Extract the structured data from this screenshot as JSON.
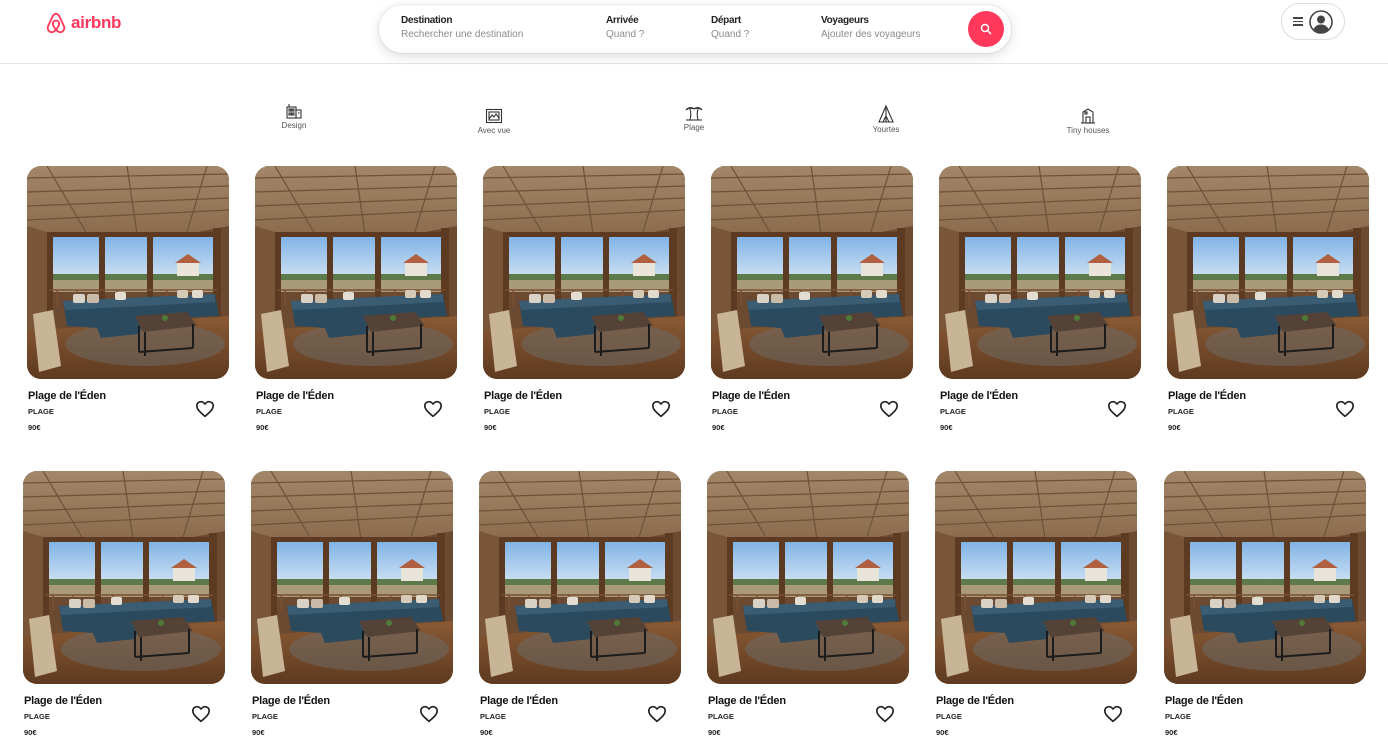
{
  "brand": {
    "name": "airbnb",
    "color": "#ff385c"
  },
  "search": {
    "destination": {
      "label": "Destination",
      "value": "Rechercher une destination"
    },
    "arrival": {
      "label": "Arrivée",
      "value": "Quand ?"
    },
    "departure": {
      "label": "Départ",
      "value": "Quand ?"
    },
    "guests": {
      "label": "Voyageurs",
      "value": "Ajouter des voyageurs"
    },
    "button_icon": "search-icon"
  },
  "user_menu": {
    "icons": [
      "menu-icon",
      "account-icon"
    ]
  },
  "categories": [
    {
      "label": "Design",
      "icon": "design-building-icon"
    },
    {
      "label": "Avec vue",
      "icon": "view-frame-icon"
    },
    {
      "label": "Plage",
      "icon": "beach-palm-icon"
    },
    {
      "label": "Yourtes",
      "icon": "yurt-tent-icon"
    },
    {
      "label": "Tiny houses",
      "icon": "tiny-house-icon"
    }
  ],
  "listings": [
    {
      "title": "Plage de l'Éden",
      "type": "PLAGE",
      "price": "90€"
    },
    {
      "title": "Plage de l'Éden",
      "type": "PLAGE",
      "price": "90€"
    },
    {
      "title": "Plage de l'Éden",
      "type": "PLAGE",
      "price": "90€"
    },
    {
      "title": "Plage de l'Éden",
      "type": "PLAGE",
      "price": "90€"
    },
    {
      "title": "Plage de l'Éden",
      "type": "PLAGE",
      "price": "90€"
    },
    {
      "title": "Plage de l'Éden",
      "type": "PLAGE",
      "price": "90€"
    },
    {
      "title": "Plage de l'Éden",
      "type": "PLAGE",
      "price": "90€"
    },
    {
      "title": "Plage de l'Éden",
      "type": "PLAGE",
      "price": "90€"
    },
    {
      "title": "Plage de l'Éden",
      "type": "PLAGE",
      "price": "90€"
    },
    {
      "title": "Plage de l'Éden",
      "type": "PLAGE",
      "price": "90€"
    },
    {
      "title": "Plage de l'Éden",
      "type": "PLAGE",
      "price": "90€"
    },
    {
      "title": "Plage de l'Éden",
      "type": "PLAGE",
      "price": "90€"
    }
  ]
}
